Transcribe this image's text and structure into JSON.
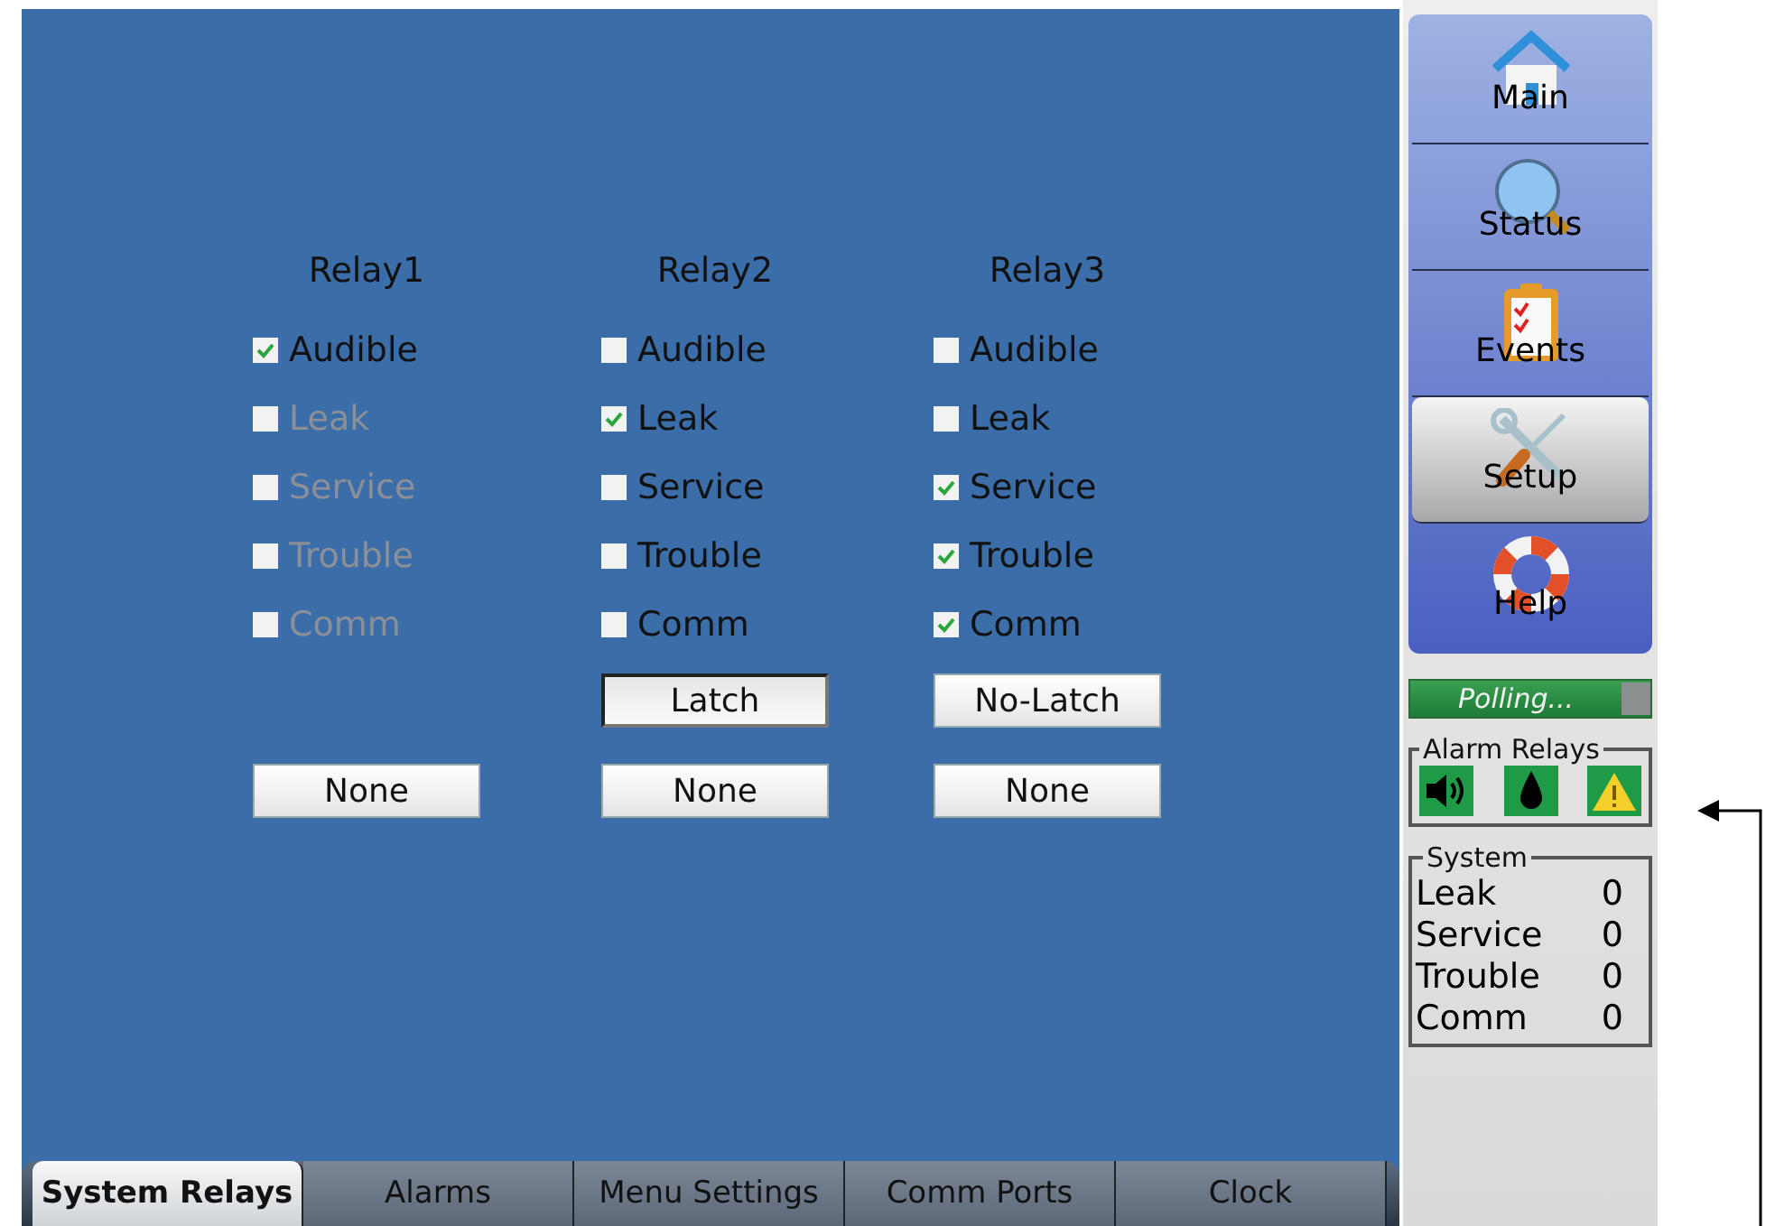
{
  "relays": [
    {
      "title": "Relay1",
      "options": [
        {
          "label": "Audible",
          "checked": true,
          "disabled": false
        },
        {
          "label": "Leak",
          "checked": false,
          "disabled": true
        },
        {
          "label": "Service",
          "checked": false,
          "disabled": true
        },
        {
          "label": "Trouble",
          "checked": false,
          "disabled": true
        },
        {
          "label": "Comm",
          "checked": false,
          "disabled": true
        }
      ],
      "none_button": "None"
    },
    {
      "title": "Relay2",
      "options": [
        {
          "label": "Audible",
          "checked": false,
          "disabled": false
        },
        {
          "label": "Leak",
          "checked": true,
          "disabled": false
        },
        {
          "label": "Service",
          "checked": false,
          "disabled": false
        },
        {
          "label": "Trouble",
          "checked": false,
          "disabled": false
        },
        {
          "label": "Comm",
          "checked": false,
          "disabled": false
        }
      ],
      "latch_button": {
        "label": "Latch",
        "pressed": true
      },
      "none_button": "None"
    },
    {
      "title": "Relay3",
      "options": [
        {
          "label": "Audible",
          "checked": false,
          "disabled": false
        },
        {
          "label": "Leak",
          "checked": false,
          "disabled": false
        },
        {
          "label": "Service",
          "checked": true,
          "disabled": false
        },
        {
          "label": "Trouble",
          "checked": true,
          "disabled": false
        },
        {
          "label": "Comm",
          "checked": true,
          "disabled": false
        }
      ],
      "latch_button": {
        "label": "No-Latch",
        "pressed": false
      },
      "none_button": "None"
    }
  ],
  "tabs": [
    {
      "label": "System Relays",
      "selected": true
    },
    {
      "label": "Alarms",
      "selected": false
    },
    {
      "label": "Menu Settings",
      "selected": false
    },
    {
      "label": "Comm Ports",
      "selected": false
    },
    {
      "label": "Clock",
      "selected": false
    }
  ],
  "nav": [
    {
      "label": "Main",
      "kind": "home",
      "selected": false
    },
    {
      "label": "Status",
      "kind": "status",
      "selected": false
    },
    {
      "label": "Events",
      "kind": "events",
      "selected": false
    },
    {
      "label": "Setup",
      "kind": "setup",
      "selected": true
    },
    {
      "label": "Help",
      "kind": "help",
      "selected": false
    }
  ],
  "polling": "Polling...",
  "alarm_relays": {
    "title": "Alarm Relays",
    "icons": [
      {
        "kind": "audible"
      },
      {
        "kind": "leak"
      },
      {
        "kind": "trouble"
      }
    ]
  },
  "system": {
    "title": "System",
    "rows": [
      {
        "label": "Leak",
        "value": "0"
      },
      {
        "label": "Service",
        "value": "0"
      },
      {
        "label": "Trouble",
        "value": "0"
      },
      {
        "label": "Comm",
        "value": "0"
      }
    ]
  }
}
